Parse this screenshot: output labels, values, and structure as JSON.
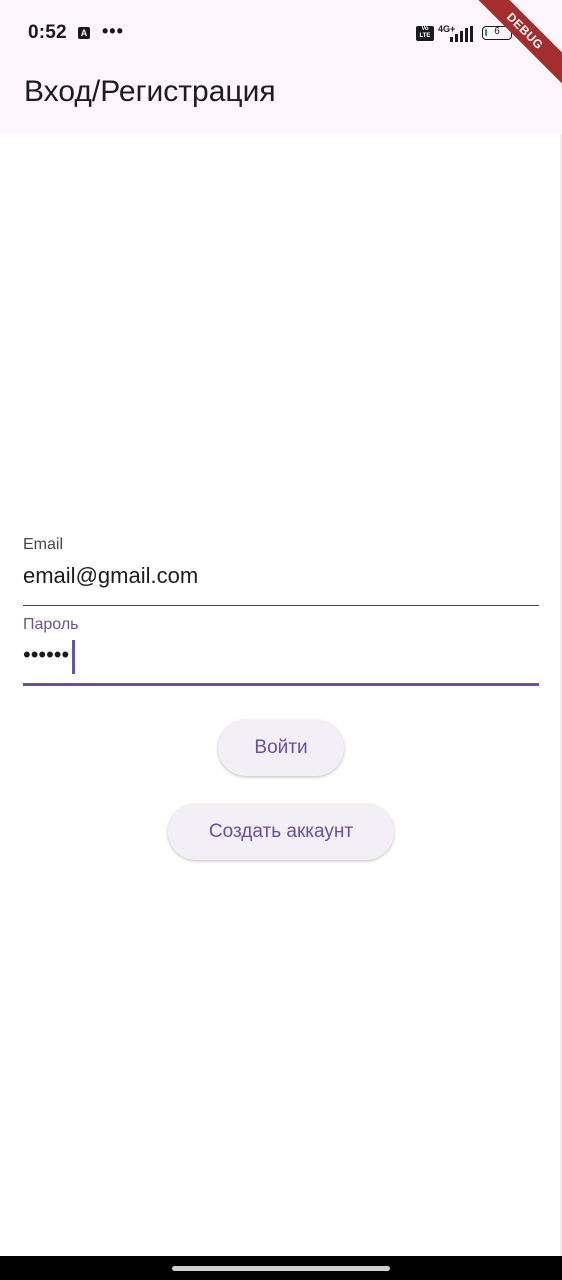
{
  "status_bar": {
    "time": "0:52",
    "a_icon_label": "A",
    "dots": "•••",
    "volte_label": "Vo LTE",
    "network": "4G+",
    "battery_level": "6"
  },
  "app_bar": {
    "title": "Вход/Регистрация"
  },
  "debug_banner": {
    "label": "DEBUG"
  },
  "form": {
    "email": {
      "label": "Email",
      "value": "email@gmail.com"
    },
    "password": {
      "label": "Пароль",
      "value": "••••••"
    }
  },
  "buttons": {
    "login_label": "Войти",
    "register_label": "Создать аккаунт"
  },
  "colors": {
    "primary": "#6750a4",
    "app_bar_bg": "#fdf6fd",
    "button_bg": "#f3eff6",
    "debug_ribbon": "#a42e2e"
  }
}
